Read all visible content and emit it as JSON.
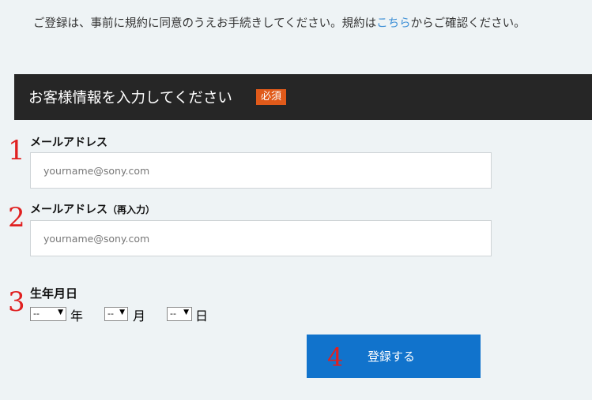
{
  "intro": {
    "before_link": "ご登録は、事前に規約に同意のうえお手続きしてください。規約は",
    "link_text": "こちら",
    "after_link": "からご確認ください。"
  },
  "section": {
    "title": "お客様情報を入力してください",
    "required_badge": "必須"
  },
  "email": {
    "label": "メールアドレス",
    "placeholder": "yourname@sony.com",
    "value": ""
  },
  "email_confirm": {
    "label": "メールアドレス",
    "label_suffix": "（再入力）",
    "placeholder": "yourname@sony.com",
    "value": ""
  },
  "birthdate": {
    "label": "生年月日",
    "year_value": "--",
    "year_unit": "年",
    "month_value": "--",
    "month_unit": "月",
    "day_value": "--",
    "day_unit": "日"
  },
  "annotations": {
    "marker1": "1",
    "marker2": "2",
    "marker3": "3",
    "marker4": "4"
  },
  "submit": {
    "label": "登録する",
    "color": "#1173cc"
  },
  "colors": {
    "accent_link": "#3d8fd6",
    "header_bg": "#262626",
    "badge_bg": "#e05a1a",
    "page_bg": "#eef3f5",
    "annotation_red": "#e02020"
  }
}
